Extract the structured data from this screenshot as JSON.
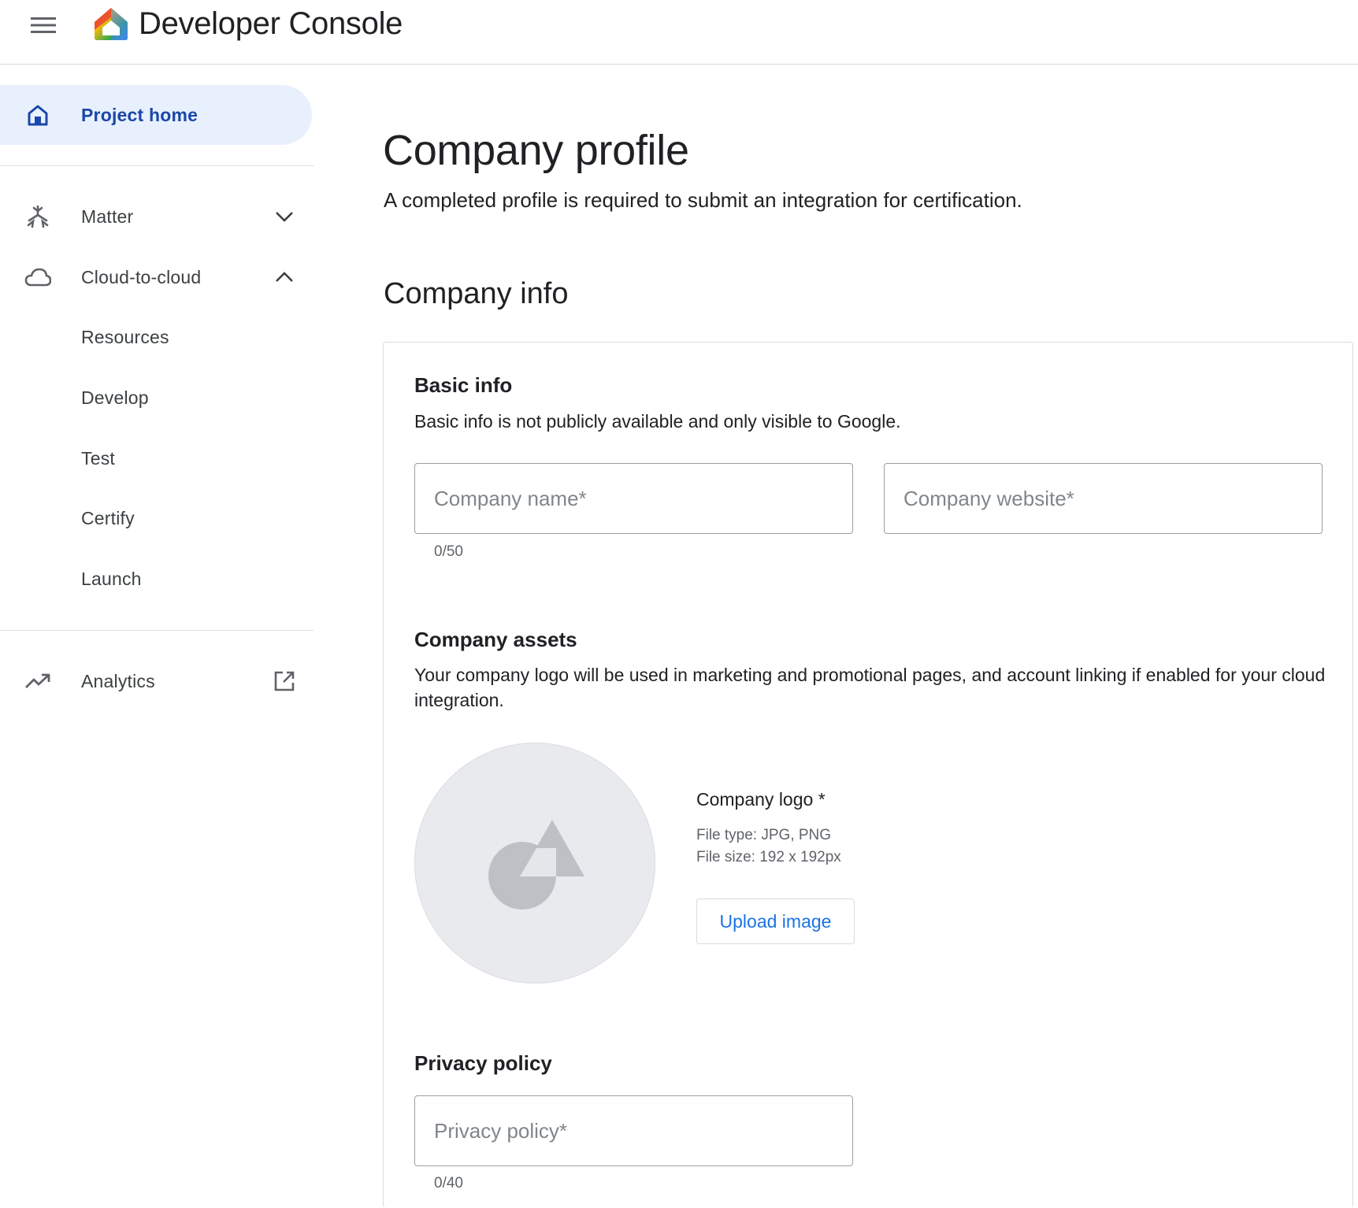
{
  "header": {
    "title": "Developer Console",
    "menu_icon": "hamburger-menu-icon",
    "logo_icon": "google-home-logo"
  },
  "sidebar": {
    "project_home": {
      "label": "Project home",
      "icon": "home-icon"
    },
    "matter": {
      "label": "Matter",
      "icon": "matter-icon",
      "trail_icon": "chevron-down-icon"
    },
    "cloud": {
      "label": "Cloud-to-cloud",
      "icon": "cloud-icon",
      "trail_icon": "chevron-up-icon"
    },
    "sub_items": [
      "Resources",
      "Develop",
      "Test",
      "Certify",
      "Launch"
    ],
    "analytics": {
      "label": "Analytics",
      "icon": "trending-up-icon",
      "trail_icon": "open-in-new-icon"
    }
  },
  "main": {
    "title": "Company profile",
    "subtitle": "A completed profile is required to submit an integration for certification.",
    "section_title": "Company info",
    "basic_info": {
      "heading": "Basic info",
      "description": "Basic info is not publicly available and only visible to Google.",
      "company_name_placeholder": "Company name*",
      "company_name_counter": "0/50",
      "company_website_placeholder": "Company website*"
    },
    "assets": {
      "heading": "Company assets",
      "description": "Your company logo will be used in marketing and promotional pages, and account linking if enabled for your cloud integration.",
      "logo_label": "Company logo *",
      "file_type": "File type: JPG, PNG",
      "file_size": "File size: 192 x 192px",
      "upload_label": "Upload image"
    },
    "privacy": {
      "heading": "Privacy policy",
      "placeholder": "Privacy policy*",
      "counter": "0/40"
    }
  },
  "colors": {
    "accent": "#1a73e8",
    "active_nav_bg": "#e8f0fe",
    "active_nav_text": "#1a47a6"
  }
}
